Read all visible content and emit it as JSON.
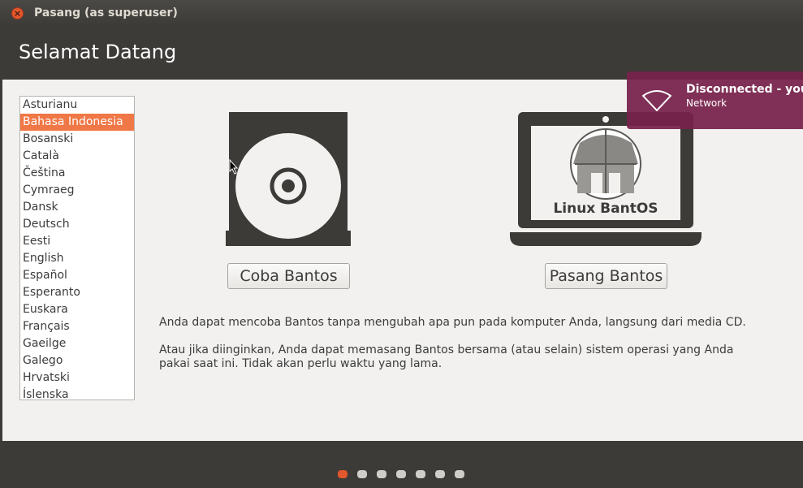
{
  "window": {
    "title": "Pasang (as superuser)",
    "close_glyph": "×"
  },
  "header": {
    "title": "Selamat Datang"
  },
  "languages": {
    "items": [
      "Asturianu",
      "Bahasa Indonesia",
      "Bosanski",
      "Català",
      "Čeština",
      "Cymraeg",
      "Dansk",
      "Deutsch",
      "Eesti",
      "English",
      "Español",
      "Esperanto",
      "Euskara",
      "Français",
      "Gaeilge",
      "Galego",
      "Hrvatski",
      "Íslenska"
    ],
    "selected": "Bahasa Indonesia"
  },
  "options": {
    "try_label": "Coba Bantos",
    "install_label": "Pasang Bantos",
    "laptop_screen_text": "Linux BantOS"
  },
  "description": {
    "line1": "Anda dapat mencoba Bantos tanpa mengubah apa pun pada komputer Anda, langsung dari media CD.",
    "line2": "Atau jika diinginkan, Anda dapat memasang Bantos bersama (atau selain) sistem operasi yang Anda pakai saat ini. Tidak akan perlu waktu yang lama."
  },
  "progress": {
    "steps": 7,
    "current_step": 1
  },
  "notification": {
    "title": "Disconnected - you a",
    "body": "Network",
    "icon": "wifi-icon"
  },
  "colors": {
    "accent": "#e2572c",
    "selection": "#f07746",
    "notification_bg": "#77214b",
    "chrome": "#3c3b37"
  }
}
